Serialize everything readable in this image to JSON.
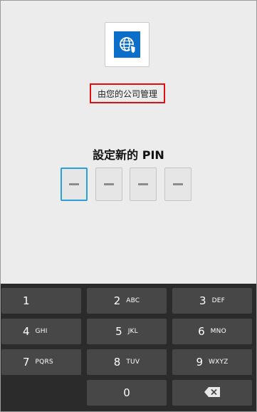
{
  "app": {
    "icon": "globe-shield-icon",
    "managed_by": "由您的公司管理"
  },
  "title": "設定新的 PIN",
  "pin": {
    "length": 4,
    "active_index": 0,
    "placeholder_char": "—"
  },
  "keypad": {
    "keys": [
      {
        "num": "1",
        "letters": ""
      },
      {
        "num": "2",
        "letters": "ABC"
      },
      {
        "num": "3",
        "letters": "DEF"
      },
      {
        "num": "4",
        "letters": "GHI"
      },
      {
        "num": "5",
        "letters": "JKL"
      },
      {
        "num": "6",
        "letters": "MNO"
      },
      {
        "num": "7",
        "letters": "PQRS"
      },
      {
        "num": "8",
        "letters": "TUV"
      },
      {
        "num": "9",
        "letters": "WXYZ"
      },
      {
        "num": "0",
        "letters": ""
      }
    ],
    "backspace_icon": "backspace-icon"
  },
  "colors": {
    "accent": "#2a9fd8",
    "brand": "#0b6fc9",
    "highlight": "#e01010",
    "key_bg": "#474747",
    "keypad_bg": "#2b2b2b",
    "screen_bg": "#ececec"
  }
}
